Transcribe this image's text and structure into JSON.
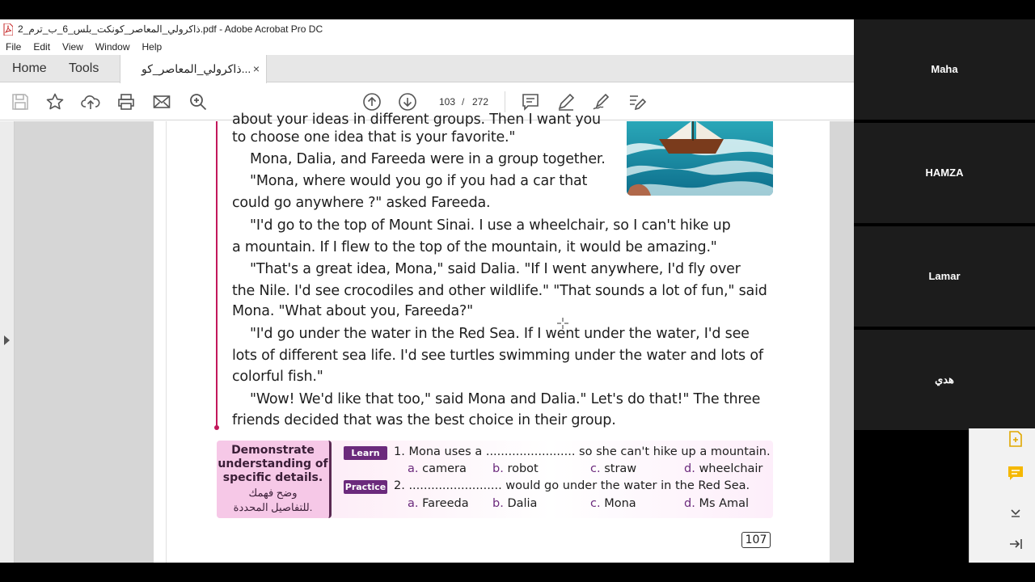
{
  "window": {
    "title": "ذاكرولي_المعاصر_كونكت_بلس_6_ب_ترم_2.pdf - Adobe Acrobat Pro DC"
  },
  "menu": [
    "File",
    "Edit",
    "View",
    "Window",
    "Help"
  ],
  "tabs": {
    "home": "Home",
    "tools": "Tools",
    "document": "ذاكرولي_المعاصر_كو...",
    "close": "×"
  },
  "toolbar": {
    "page_current": "103",
    "page_sep": "/",
    "page_total": "272",
    "icons": [
      "save-icon",
      "star-icon",
      "upload-icon",
      "print-icon",
      "mail-icon",
      "search-icon",
      "page-up-icon",
      "page-down-icon",
      "comment-icon",
      "pen-icon",
      "sign-icon",
      "edit-icon"
    ]
  },
  "story": {
    "lines": [
      "about your ideas in different groups. Then I want you",
      "to choose one idea that is your favorite.\"",
      "Mona, Dalia, and Fareeda were in a group together.",
      "\"Mona, where would you go if you had a car that",
      "could go anywhere ?\" asked Fareeda.",
      "\"I'd go to the top of Mount Sinai. I use a wheelchair, so I can't hike up",
      "a mountain. If I flew to the top of the mountain, it would be amazing.\"",
      "\"That's a great idea, Mona,\" said Dalia. \"If I went anywhere, I'd fly over",
      "the Nile. I'd see crocodiles and other wildlife.\" \"That sounds a lot of fun,\" said",
      "Mona. \"What about you, Fareeda?\"",
      "\"I'd go under the water in the Red Sea. If I went under the water, I'd see",
      "lots of different sea life. I'd see turtles swimming under the water and lots of",
      "colorful fish.\"",
      "\"Wow! We'd like that too,\" said Mona and Dalia.\" Let's do that!\" The three",
      "friends decided that was the best choice in their group."
    ]
  },
  "activity": {
    "heading_en": [
      "Demonstrate",
      "understanding of",
      "specific details."
    ],
    "heading_ar": [
      "وضح فهمك",
      "للتفاصيل المحددة."
    ],
    "learn_badge": "Learn",
    "practice_badge": "Practice",
    "q1": "1. Mona uses a ........................ so she can't hike up a mountain.",
    "q1_options": [
      {
        "letter": "a.",
        "text": "camera"
      },
      {
        "letter": "b.",
        "text": "robot"
      },
      {
        "letter": "c.",
        "text": "straw"
      },
      {
        "letter": "d.",
        "text": "wheelchair"
      }
    ],
    "q2": "2. ......................... would go under the water in the Red Sea.",
    "q2_options": [
      {
        "letter": "a.",
        "text": "Fareeda"
      },
      {
        "letter": "b.",
        "text": "Dalia"
      },
      {
        "letter": "c.",
        "text": "Mona"
      },
      {
        "letter": "d.",
        "text": "Ms Amal"
      }
    ]
  },
  "page_number": "107",
  "participants": [
    "Maha",
    "HAMZA",
    "Lamar",
    "هدي"
  ],
  "colors": {
    "accent": "#6b2a7c",
    "story_line": "#c2185b",
    "demo_box": "#f6c8e7"
  }
}
